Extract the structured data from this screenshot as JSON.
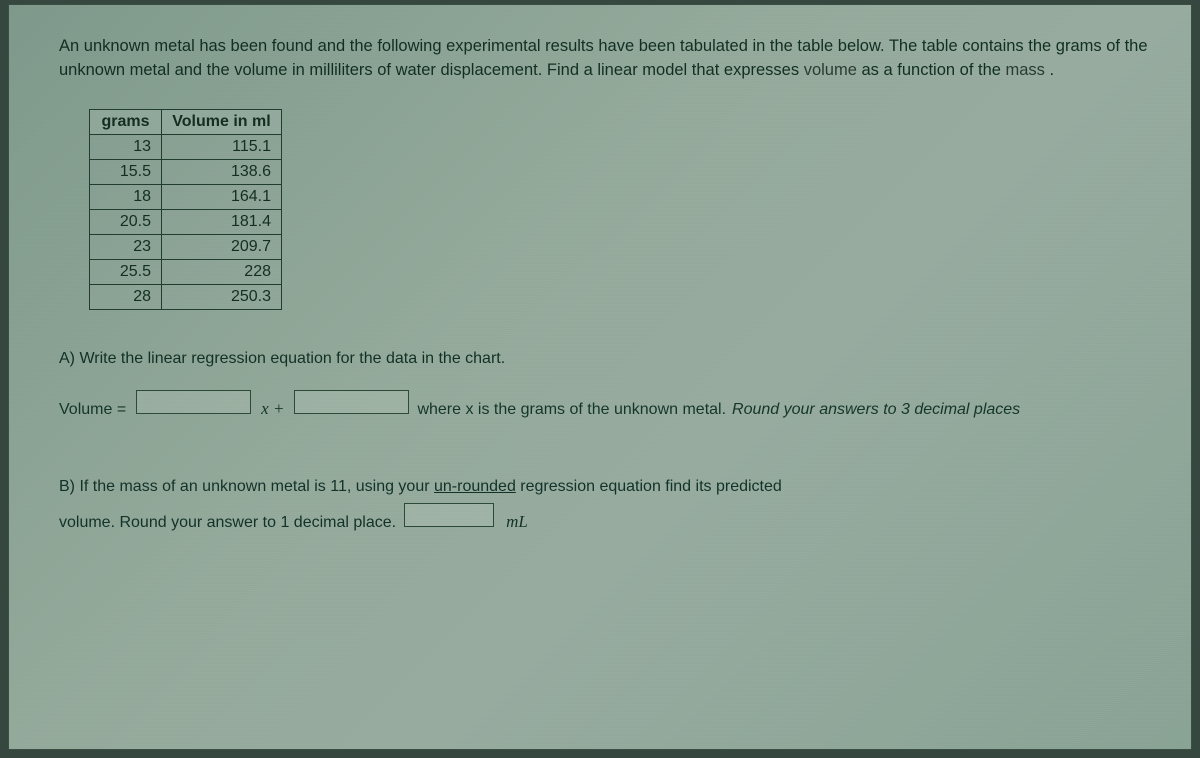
{
  "intro": {
    "line": "An unknown metal has been found and the following experimental results have been tabulated in the table below. The table contains the grams of the unknown metal and the volume in milliliters of water displacement. Find a linear model that expresses ",
    "emph": "volume",
    "tail": " as a function of the ",
    "emph2": "mass",
    "period": "."
  },
  "table": {
    "headers": {
      "grams": "grams",
      "volume": "Volume in ml"
    },
    "rows": [
      {
        "g": "13",
        "v": "115.1"
      },
      {
        "g": "15.5",
        "v": "138.6"
      },
      {
        "g": "18",
        "v": "164.1"
      },
      {
        "g": "20.5",
        "v": "181.4"
      },
      {
        "g": "23",
        "v": "209.7"
      },
      {
        "g": "25.5",
        "v": "228"
      },
      {
        "g": "28",
        "v": "250.3"
      }
    ]
  },
  "partA": {
    "prompt": "A) Write the linear regression equation for the data in the chart.",
    "volume_label": "Volume =",
    "x_plus": "x +",
    "tail": "where x is the grams of the unknown metal. ",
    "round_ital": "Round your answers to 3 decimal places"
  },
  "partB": {
    "line1a": "B)  If the mass of an unknown metal is 11, using your ",
    "unrounded": "un-rounded",
    "line1b": " regression equation find its predicted",
    "line2a": "volume.  Round your answer to 1 decimal place.",
    "unit": "mL"
  },
  "chart_data": {
    "type": "table",
    "title": "Mass vs Volume experimental data",
    "columns": [
      "grams",
      "Volume in ml"
    ],
    "rows": [
      [
        13,
        115.1
      ],
      [
        15.5,
        138.6
      ],
      [
        18,
        164.1
      ],
      [
        20.5,
        181.4
      ],
      [
        23,
        209.7
      ],
      [
        25.5,
        228
      ],
      [
        28,
        250.3
      ]
    ]
  }
}
